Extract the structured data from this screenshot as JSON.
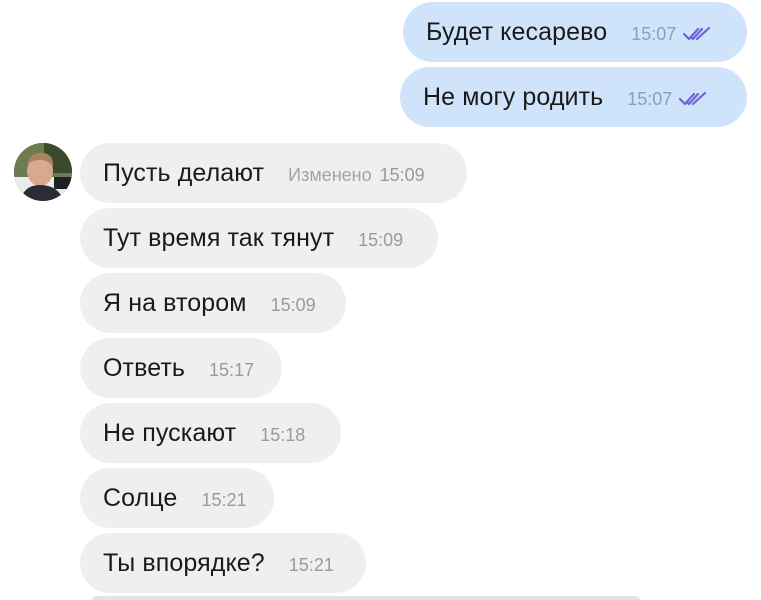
{
  "accent_out_bubble": "#cfe4fb",
  "accent_in_bubble": "#efefef",
  "read_tick_color": "#6b63d8",
  "messages": [
    {
      "side": "out",
      "text": "Будет кесарево",
      "time": "15:07",
      "status": "double-check-icon"
    },
    {
      "side": "out",
      "text": "Не могу родить",
      "time": "15:07",
      "status": "double-check-icon"
    },
    {
      "side": "in",
      "text": "Пусть делают",
      "edited": "Изменено",
      "time": "15:09"
    },
    {
      "side": "in",
      "text": "Тут время так тянут",
      "time": "15:09"
    },
    {
      "side": "in",
      "text": "Я на втором",
      "time": "15:09"
    },
    {
      "side": "in",
      "text": "Ответь",
      "time": "15:17"
    },
    {
      "side": "in",
      "text": "Не пускают",
      "time": "15:18"
    },
    {
      "side": "in",
      "text": "Солце",
      "time": "15:21"
    },
    {
      "side": "in",
      "text": "Ты впорядке?",
      "time": "15:21"
    }
  ]
}
